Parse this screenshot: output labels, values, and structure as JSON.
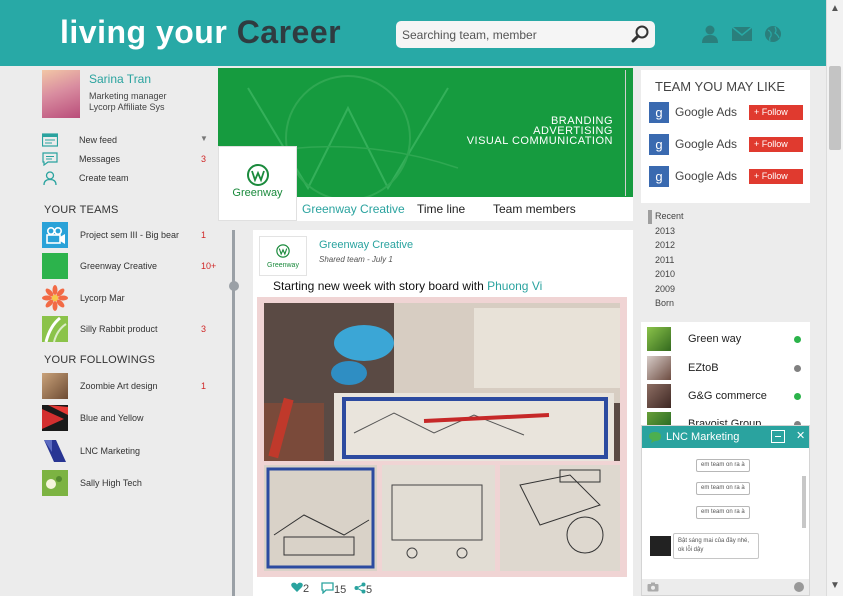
{
  "header": {
    "logo_part1": "living your",
    "logo_part2": "Career",
    "search_placeholder": "Searching team, member"
  },
  "profile": {
    "name": "Sarina Tran",
    "role": "Marketing manager",
    "org": "Lycorp Affiliate Sys"
  },
  "menu": [
    {
      "label": "New feed",
      "count": "",
      "icon": "newsfeed-icon"
    },
    {
      "label": "Messages",
      "count": "3",
      "icon": "messages-icon"
    },
    {
      "label": "Create team",
      "count": "",
      "icon": "create-team-icon"
    }
  ],
  "your_teams": {
    "title": "YOUR TEAMS",
    "items": [
      {
        "label": "Project sem III - Big bear",
        "count": "1"
      },
      {
        "label": "Greenway Creative",
        "count": "10+"
      },
      {
        "label": "Lycorp Mar",
        "count": ""
      },
      {
        "label": "Silly Rabbit product",
        "count": "3"
      }
    ]
  },
  "your_followings": {
    "title": "YOUR FOLLOWINGS",
    "items": [
      {
        "label": "Zoombie Art design",
        "count": "1"
      },
      {
        "label": "Blue and Yellow",
        "count": ""
      },
      {
        "label": "LNC Marketing",
        "count": ""
      },
      {
        "label": "Sally High Tech",
        "count": ""
      }
    ]
  },
  "banner": {
    "line1": "BRANDING",
    "line2": "ADVERTISING",
    "line3": "VISUAL COMMUNICATION",
    "logo_text": "Greenway"
  },
  "tabs": [
    "Greenway Creative",
    "Time line",
    "Team members"
  ],
  "post": {
    "avatar_text": "Greenway",
    "author": "Greenway Creative",
    "meta": "Shared team - July 1",
    "text": "Starting new week with story board with ",
    "mention": "Phuong Vi",
    "likes": "2",
    "comments": "15",
    "shares": "5"
  },
  "team_you_may_like": {
    "title": "TEAM YOU MAY LIKE",
    "items": [
      {
        "label": "Google Ads",
        "button": "Follow"
      },
      {
        "label": "Google Ads",
        "button": "Follow"
      },
      {
        "label": "Google Ads",
        "button": "Follow"
      }
    ]
  },
  "timeline_years": [
    "Recent",
    "2013",
    "2012",
    "2011",
    "2010",
    "2009",
    "Born"
  ],
  "contacts": [
    {
      "name": "Green way",
      "status": "online"
    },
    {
      "name": "EZtoB",
      "status": "offline"
    },
    {
      "name": "G&G commerce",
      "status": "online"
    },
    {
      "name": "Bravoist Group",
      "status": "offline"
    }
  ],
  "colors": {
    "accent": "#2aa39f",
    "header": "#28a9a6",
    "banner": "#169b3f",
    "alert": "#d02828",
    "online": "#2bb34a",
    "offline": "#808080"
  },
  "chat": {
    "title": "LNC Marketing",
    "messages": [
      "em team on ra à",
      "em team on ra à",
      "em team on ra à"
    ],
    "received": "Bật sáng mai của đây nhé, ok lỗi dậy"
  }
}
